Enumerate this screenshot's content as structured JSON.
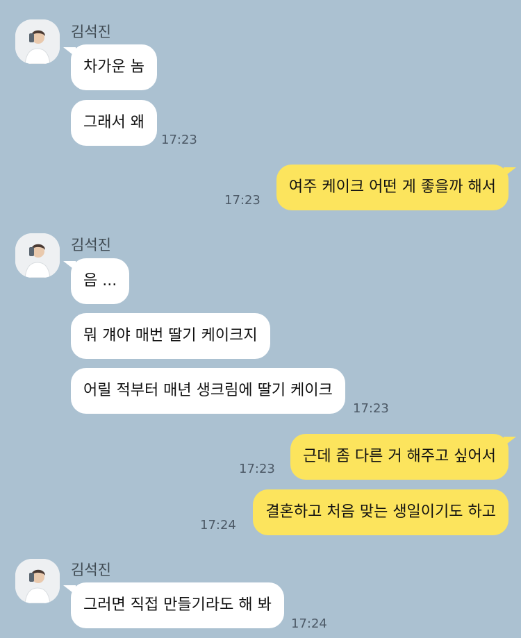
{
  "sender_name": "김석진",
  "avatar_icon": "profile-photo-avatar",
  "colors": {
    "background": "#abc1d1",
    "incoming": "#ffffff",
    "outgoing": "#fce45d"
  },
  "messages": [
    {
      "from": "them",
      "text": "차가운 놈",
      "time": ""
    },
    {
      "from": "them",
      "text": "그래서 왜",
      "time": "17:23"
    },
    {
      "from": "me",
      "text": "여주 케이크 어떤 게 좋을까 해서",
      "time": "17:23"
    },
    {
      "from": "them",
      "text": "음 ...",
      "time": ""
    },
    {
      "from": "them",
      "text": "뭐 걔야 매번 딸기 케이크지",
      "time": ""
    },
    {
      "from": "them",
      "text": "어릴 적부터 매년 생크림에 딸기 케이크",
      "time": "17:23"
    },
    {
      "from": "me",
      "text": "근데 좀 다른 거 해주고 싶어서",
      "time": "17:23"
    },
    {
      "from": "me",
      "text": "결혼하고 처음 맞는 생일이기도 하고",
      "time": "17:24"
    },
    {
      "from": "them",
      "text": "그러면 직접 만들기라도 해 봐",
      "time": "17:24"
    }
  ]
}
